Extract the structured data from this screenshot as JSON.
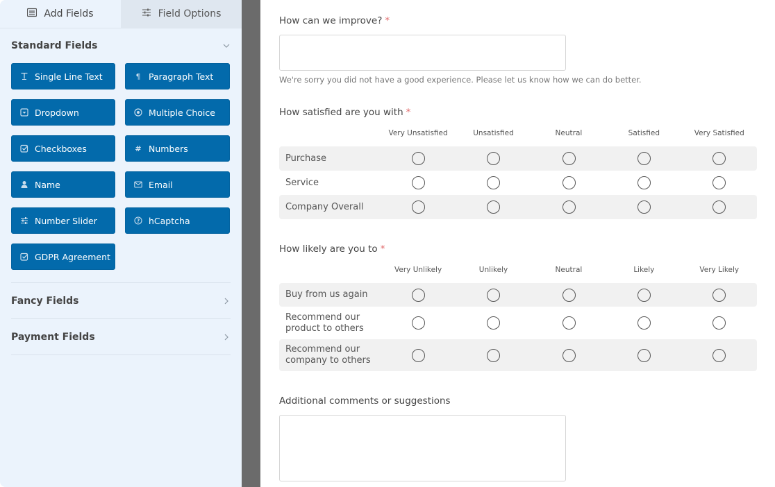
{
  "sidebar": {
    "tabs": [
      {
        "label": "Add Fields",
        "icon": "list-icon",
        "active": true
      },
      {
        "label": "Field Options",
        "icon": "sliders-icon",
        "active": false
      }
    ],
    "standard_fields": {
      "title": "Standard Fields",
      "expanded": true,
      "buttons": [
        {
          "label": "Single Line Text",
          "icon": "text-cursor-icon"
        },
        {
          "label": "Paragraph Text",
          "icon": "pilcrow-icon"
        },
        {
          "label": "Dropdown",
          "icon": "dropdown-icon"
        },
        {
          "label": "Multiple Choice",
          "icon": "radio-dot-icon"
        },
        {
          "label": "Checkboxes",
          "icon": "checkbox-icon"
        },
        {
          "label": "Numbers",
          "icon": "hash-icon"
        },
        {
          "label": "Name",
          "icon": "user-icon"
        },
        {
          "label": "Email",
          "icon": "envelope-icon"
        },
        {
          "label": "Number Slider",
          "icon": "sliders-icon"
        },
        {
          "label": "hCaptcha",
          "icon": "question-circle-icon"
        },
        {
          "label": "GDPR Agreement",
          "icon": "checkbox-icon"
        }
      ]
    },
    "fancy_fields": {
      "title": "Fancy Fields",
      "expanded": false
    },
    "payment_fields": {
      "title": "Payment Fields",
      "expanded": false
    }
  },
  "form": {
    "improve": {
      "label": "How can we improve?",
      "required_mark": "*",
      "value": "",
      "help": "We're sorry you did not have a good experience. Please let us know how we can do better."
    },
    "satisfaction": {
      "label": "How satisfied are you with",
      "required_mark": "*",
      "columns": [
        "Very Unsatisfied",
        "Unsatisfied",
        "Neutral",
        "Satisfied",
        "Very Satisfied"
      ],
      "rows": [
        "Purchase",
        "Service",
        "Company Overall"
      ]
    },
    "likelihood": {
      "label": "How likely are you to",
      "required_mark": "*",
      "columns": [
        "Very Unlikely",
        "Unlikely",
        "Neutral",
        "Likely",
        "Very Likely"
      ],
      "rows": [
        "Buy from us again",
        "Recommend our product to others",
        "Recommend our company to others"
      ]
    },
    "comments": {
      "label": "Additional comments or suggestions",
      "value": ""
    }
  }
}
